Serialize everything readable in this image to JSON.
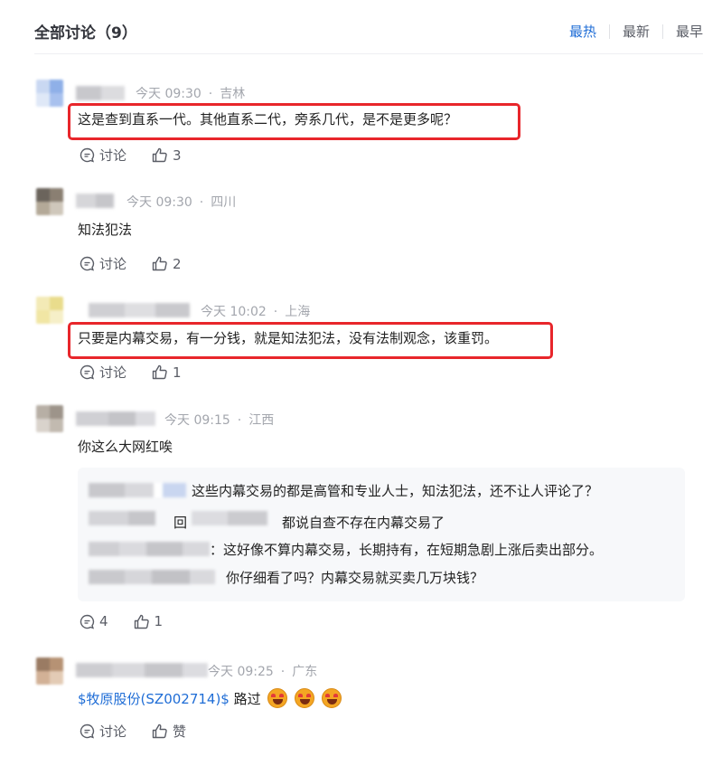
{
  "header": {
    "title": "全部讨论（9）",
    "sort": [
      "最热",
      "最新",
      "最早"
    ],
    "active_sort": "最热"
  },
  "comments": [
    {
      "time": "今天 09:30",
      "location": "吉林",
      "text": "这是查到直系一代。其他直系二代，旁系几代，是不是更多呢？",
      "highlighted": true,
      "discuss_label": "讨论",
      "likes": "3"
    },
    {
      "time": "今天 09:30",
      "location": "四川",
      "text": "知法犯法",
      "highlighted": false,
      "discuss_label": "讨论",
      "likes": "2"
    },
    {
      "time": "今天 10:02",
      "location": "上海",
      "text": "只要是内幕交易，有一分钱，就是知法犯法，没有法制观念，该重罚。",
      "highlighted": true,
      "discuss_label": "讨论",
      "likes": "1"
    },
    {
      "time": "今天 09:15",
      "location": "江西",
      "text": "你这么大网红唉",
      "highlighted": false,
      "discuss_label": "4",
      "likes": "1",
      "replies": [
        "这些内幕交易的都是高管和专业人士，知法犯法，还不让人评论了？",
        "回",
        "都说自查不存在内幕交易了",
        "：这好像不算内幕交易，长期持有，在短期急剧上涨后卖出部分。",
        "你仔细看了吗？内幕交易就买卖几万块钱？"
      ]
    },
    {
      "time": "今天 09:25",
      "location": "广东",
      "stock_tag": "$牧原股份(SZ002714)$",
      "text": "路过",
      "highlighted": false,
      "discuss_label": "讨论",
      "likes": "赞"
    }
  ],
  "colors": {
    "accent": "#1f6dd6",
    "highlight_border": "#e8262b",
    "meta_text": "#a3a6ad",
    "reply_bg": "#f7f8fa"
  },
  "icons": {
    "discuss": "comment-icon",
    "like": "thumbs-up-icon",
    "emoji": "star-struck-emoji"
  }
}
